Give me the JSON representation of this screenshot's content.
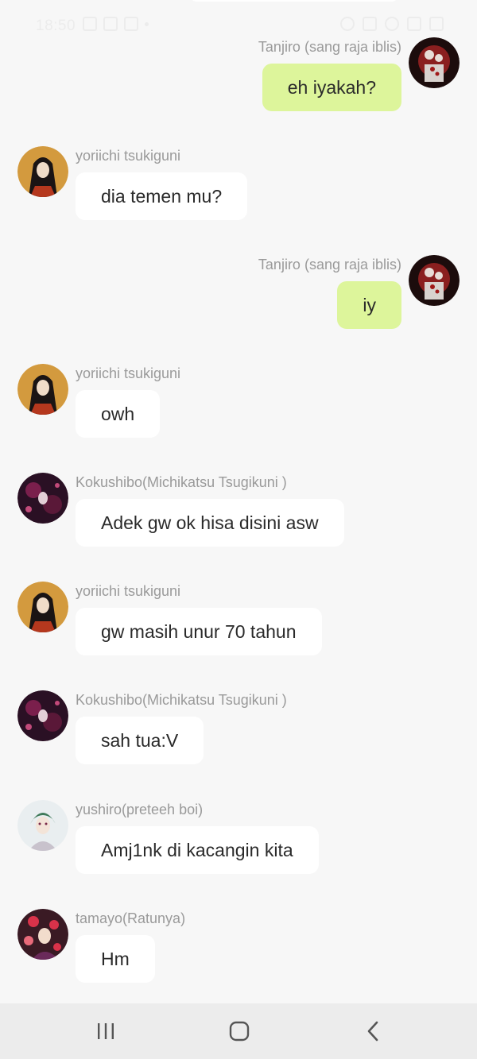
{
  "status_bar": {
    "time": "18:50",
    "icons": [
      "gallery-icon",
      "notification-icon",
      "message-icon",
      "dot-icon",
      "alarm-icon",
      "mute-icon",
      "wifi-icon",
      "signal-icon",
      "battery-icon"
    ]
  },
  "messages": [
    {
      "direction": "out",
      "sender": "Tanjiro (sang raja iblis)",
      "text": "eh iyakah?",
      "avatar": "tanjiro-avatar"
    },
    {
      "direction": "in",
      "sender": "yoriichi tsukiguni",
      "text": "dia temen mu?",
      "avatar": "yoriichi-avatar"
    },
    {
      "direction": "out",
      "sender": "Tanjiro (sang raja iblis)",
      "text": "iy",
      "avatar": "tanjiro-avatar"
    },
    {
      "direction": "in",
      "sender": "yoriichi tsukiguni",
      "text": "owh",
      "avatar": "yoriichi-avatar"
    },
    {
      "direction": "in",
      "sender": "Kokushibo(Michikatsu Tsugikuni )",
      "text": "Adek gw ok hisa disini asw",
      "avatar": "kokushibo-avatar"
    },
    {
      "direction": "in",
      "sender": "yoriichi tsukiguni",
      "text": "gw masih unur 70 tahun",
      "avatar": "yoriichi-avatar"
    },
    {
      "direction": "in",
      "sender": "Kokushibo(Michikatsu Tsugikuni )",
      "text": "sah tua:V",
      "avatar": "kokushibo-avatar"
    },
    {
      "direction": "in",
      "sender": "yushiro(preteeh boi)",
      "text": "Amj1nk di kacangin kita",
      "avatar": "yushiro-avatar"
    },
    {
      "direction": "in",
      "sender": "tamayo(Ratunya)",
      "text": "Hm",
      "avatar": "tamayo-avatar"
    }
  ],
  "colors": {
    "background": "#f7f7f7",
    "outgoing_bubble": "#ddf59b",
    "incoming_bubble": "#ffffff",
    "name_text": "#9a9a9a",
    "nav_bar": "#ececec"
  },
  "nav_bar": {
    "icons": [
      "recent-apps-icon",
      "home-icon",
      "back-icon"
    ]
  }
}
